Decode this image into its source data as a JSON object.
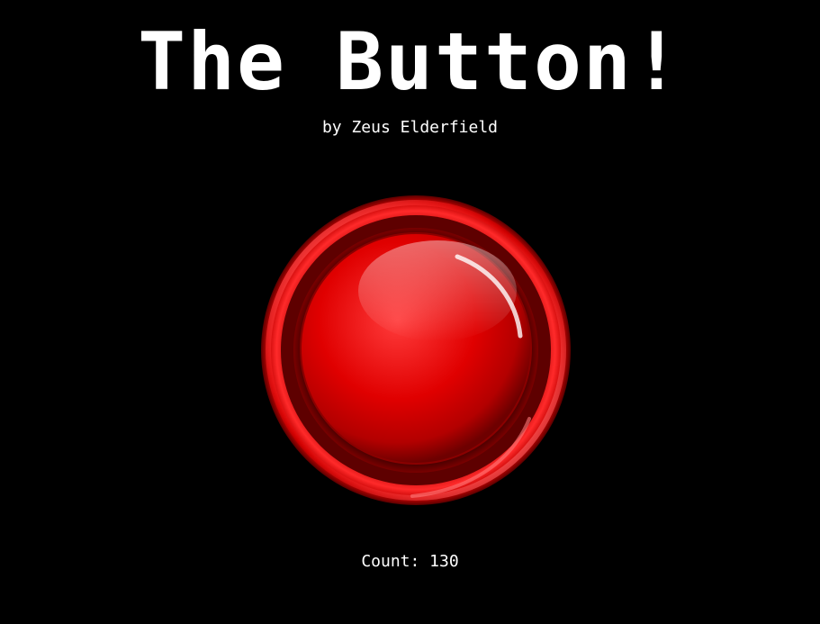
{
  "header": {
    "title": "The Button!",
    "byline": "by Zeus Elderfield"
  },
  "button": {
    "icon": "red-push-button-icon",
    "colors": {
      "base": "#d40000",
      "bright": "#ff1a1a",
      "dark": "#6b0000",
      "background": "#000000"
    }
  },
  "counter": {
    "text": "Count: 130"
  }
}
